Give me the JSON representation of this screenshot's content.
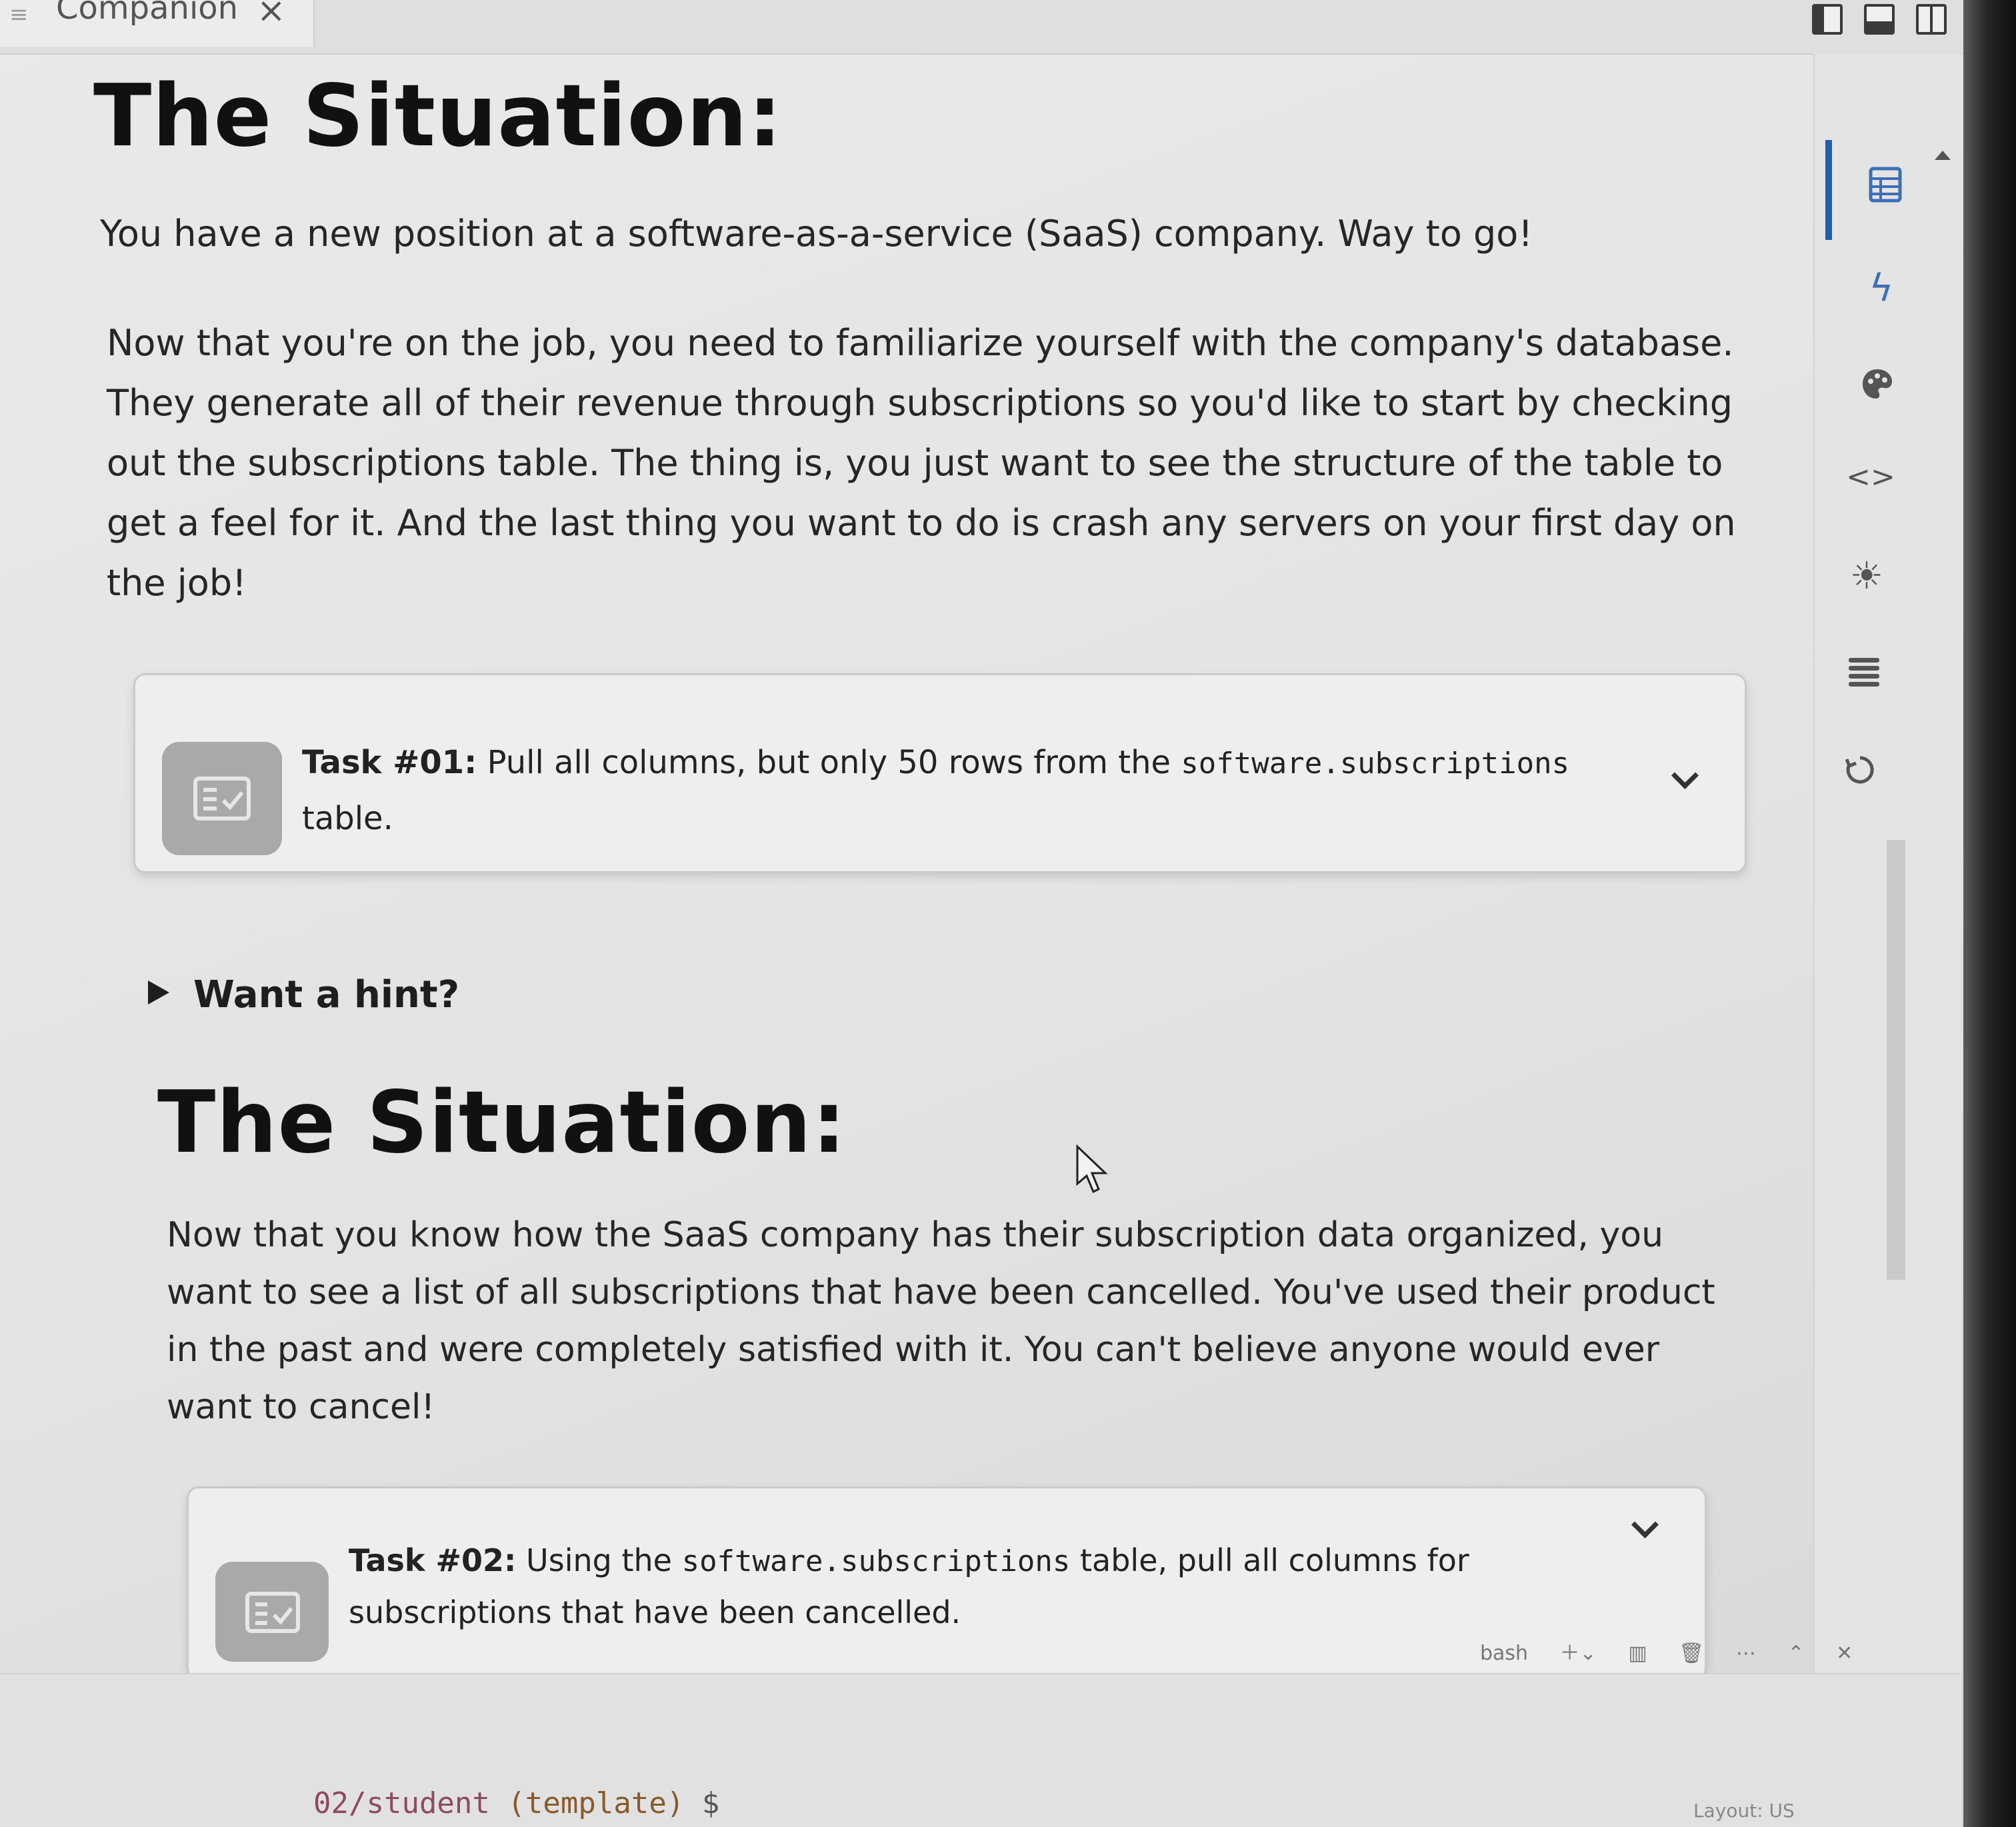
{
  "tab": {
    "title": "Companion",
    "close_glyph": "×",
    "menu_icon": "menu-icon"
  },
  "sections": [
    {
      "heading": "The Situation:",
      "paragraphs": [
        [
          "You have a new position at a software-as-a-service (SaaS) company. Way to go!"
        ],
        [
          "Now that you're on the job, you need to familiarize yourself with the company's database.",
          "They generate all of their revenue through subscriptions so you'd like to start by checking",
          "out the subscriptions table. The thing is, you just want to see the structure of the table to",
          "get a feel for it. And the last thing you want to do is crash any servers on your first day on",
          "the job!"
        ]
      ],
      "task": {
        "label": "Task #01:",
        "text_before": " Pull all columns, but only 50 rows from the ",
        "code": "software.subscriptions",
        "text_after": "table."
      }
    },
    {
      "heading": "The Situation:",
      "paragraphs": [
        [
          "Now that you know how the SaaS company has their subscription data organized, you",
          "want to see a list of all subscriptions that have been cancelled. You've used their product",
          "in the past and were completely satisfied with it. You can't believe anyone would ever",
          "want to cancel!"
        ]
      ],
      "task": {
        "label": "Task #02:",
        "text_before": " Using the ",
        "code": "software.subscriptions",
        "text_mid": " table, pull all columns for",
        "text_after": "subscriptions that have been cancelled."
      }
    }
  ],
  "hint": {
    "label": "Want a hint?"
  },
  "sidebar": {
    "icons": [
      "table-icon",
      "lightning-icon",
      "palette-icon",
      "code-icon",
      "sun-icon",
      "list-icon",
      "refresh-icon"
    ]
  },
  "terminal": {
    "shell_label": "bash",
    "prompt_path": "02/student",
    "prompt_branch": "(template)",
    "prompt_sign": "$",
    "status_right": "Layout: US"
  }
}
